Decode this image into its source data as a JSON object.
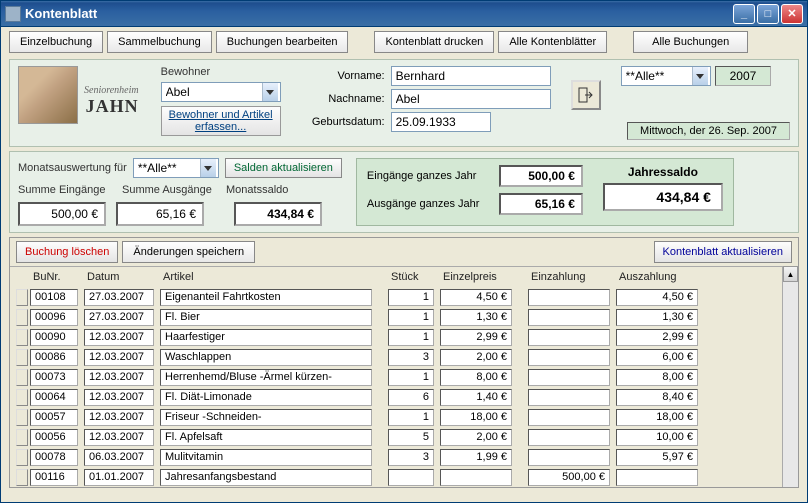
{
  "window": {
    "title": "Kontenblatt"
  },
  "tabs": {
    "einzel": "Einzelbuchung",
    "sammel": "Sammelbuchung",
    "bearb": "Buchungen bearbeiten",
    "druck": "Kontenblatt drucken",
    "alleblatt": "Alle Kontenblätter",
    "allebuch": "Alle Buchungen"
  },
  "logo": {
    "line1": "Seniorenheim",
    "line2": "JAHN"
  },
  "bewohner": {
    "label": "Bewohner",
    "value": "Abel",
    "erfassen": "Bewohner und Artikel erfassen..."
  },
  "person": {
    "vorname_lbl": "Vorname:",
    "vorname": "Bernhard",
    "nachname_lbl": "Nachname:",
    "nachname": "Abel",
    "geb_lbl": "Geburtsdatum:",
    "geb": "25.09.1933"
  },
  "topright": {
    "filter": "**Alle**",
    "year": "2007",
    "date": "Mittwoch, der 26. Sep. 2007"
  },
  "month": {
    "label": "Monatsauswertung für",
    "filter": "**Alle**",
    "salden": "Salden aktualisieren",
    "sum_ein_lbl": "Summe Eingänge",
    "sum_aus_lbl": "Summe Ausgänge",
    "saldo_lbl": "Monatssaldo",
    "sum_ein": "500,00 €",
    "sum_aus": "65,16 €",
    "saldo": "434,84 €"
  },
  "year": {
    "ein_lbl": "Eingänge ganzes Jahr",
    "ein": "500,00 €",
    "aus_lbl": "Ausgänge ganzes Jahr",
    "aus": "65,16 €",
    "saldo_lbl": "Jahressaldo",
    "saldo": "434,84 €"
  },
  "tbar": {
    "del": "Buchung löschen",
    "save": "Änderungen speichern",
    "refresh": "Kontenblatt aktualisieren"
  },
  "cols": {
    "bu": "BuNr.",
    "dat": "Datum",
    "art": "Artikel",
    "stk": "Stück",
    "ep": "Einzelpreis",
    "ein": "Einzahlung",
    "aus": "Auszahlung"
  },
  "rows": [
    {
      "bu": "00108",
      "dat": "27.03.2007",
      "art": "Eigenanteil Fahrtkosten",
      "stk": "1",
      "ep": "4,50 €",
      "ein": "",
      "aus": "4,50 €"
    },
    {
      "bu": "00096",
      "dat": "27.03.2007",
      "art": "Fl. Bier",
      "stk": "1",
      "ep": "1,30 €",
      "ein": "",
      "aus": "1,30 €"
    },
    {
      "bu": "00090",
      "dat": "12.03.2007",
      "art": "Haarfestiger",
      "stk": "1",
      "ep": "2,99 €",
      "ein": "",
      "aus": "2,99 €"
    },
    {
      "bu": "00086",
      "dat": "12.03.2007",
      "art": "Waschlappen",
      "stk": "3",
      "ep": "2,00 €",
      "ein": "",
      "aus": "6,00 €"
    },
    {
      "bu": "00073",
      "dat": "12.03.2007",
      "art": "Herrenhemd/Bluse -Ärmel kürzen-",
      "stk": "1",
      "ep": "8,00 €",
      "ein": "",
      "aus": "8,00 €"
    },
    {
      "bu": "00064",
      "dat": "12.03.2007",
      "art": "Fl. Diät-Limonade",
      "stk": "6",
      "ep": "1,40 €",
      "ein": "",
      "aus": "8,40 €"
    },
    {
      "bu": "00057",
      "dat": "12.03.2007",
      "art": "Friseur -Schneiden-",
      "stk": "1",
      "ep": "18,00 €",
      "ein": "",
      "aus": "18,00 €"
    },
    {
      "bu": "00056",
      "dat": "12.03.2007",
      "art": "Fl. Apfelsaft",
      "stk": "5",
      "ep": "2,00 €",
      "ein": "",
      "aus": "10,00 €"
    },
    {
      "bu": "00078",
      "dat": "06.03.2007",
      "art": "Mulitvitamin",
      "stk": "3",
      "ep": "1,99 €",
      "ein": "",
      "aus": "5,97 €"
    },
    {
      "bu": "00116",
      "dat": "01.01.2007",
      "art": "Jahresanfangsbestand",
      "stk": "",
      "ep": "",
      "ein": "500,00 €",
      "aus": ""
    }
  ]
}
